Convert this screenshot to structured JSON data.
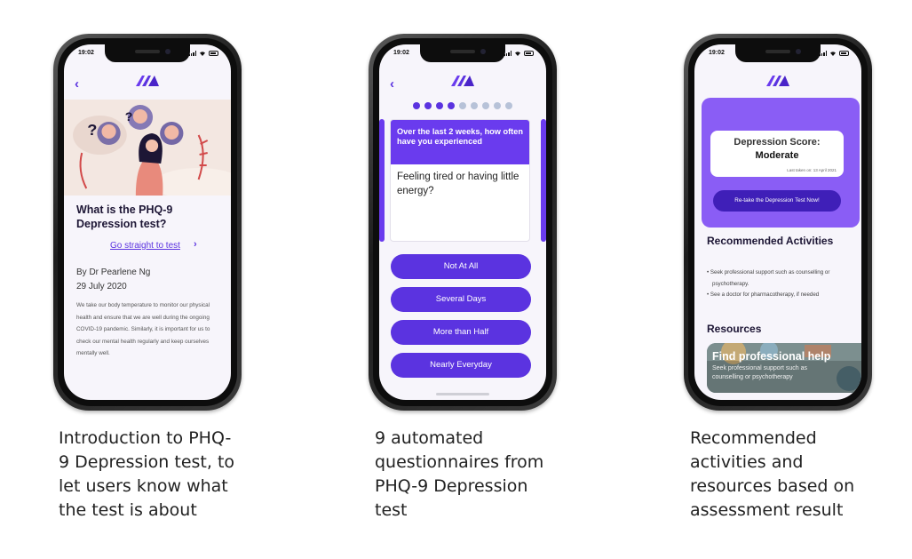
{
  "screens": [
    {
      "status_time": "19:02",
      "title": "What is the PHQ-9 Depression test?",
      "link": "Go straight to test",
      "author": "By Dr Pearlene Ng",
      "date": "29 July 2020",
      "body": "We take our body temperature to monitor our physical health and ensure that we are well during the ongoing COVID-19 pandemic. Similarly, it is important for us to check our mental health regularly and keep ourselves mentally well.",
      "caption": "Introduction to PHQ-9 Depression test, to let users know what the test is about"
    },
    {
      "status_time": "19:02",
      "progress": {
        "total": 9,
        "current": 4
      },
      "question_header": "Over the last 2 weeks, how often have you experienced",
      "question": "Feeling tired or having little energy?",
      "answers": [
        "Not At All",
        "Several Days",
        "More than Half",
        "Nearly Everyday"
      ],
      "caption": "9 automated questionnaires from PHQ-9 Depression test"
    },
    {
      "status_time": "19:02",
      "score_label": "Depression Score:",
      "score_value": "Moderate",
      "last_taken": "Last taken on: 13 April 2021",
      "retake_button": "Re-take the Depression Test Now!",
      "activities_title": "Recommended Activities",
      "activities": [
        "Seek professional support such as counselling or psychotherapy.",
        "See a doctor for pharmacotherapy, if needed"
      ],
      "resources_title": "Resources",
      "resource_banner_title": "Find professional help",
      "resource_banner_sub": "Seek professional support such as counselling or psychotherapy",
      "caption": "Recommended activities and resources based on assessment result"
    }
  ],
  "colors": {
    "accent": "#5b33e0",
    "panel": "#8a5df5",
    "dark_button": "#3f1fb8"
  },
  "icons": [
    "back-chevron-icon",
    "app-logo-icon",
    "signal-icon",
    "wifi-icon",
    "battery-icon",
    "chevron-right-icon"
  ]
}
